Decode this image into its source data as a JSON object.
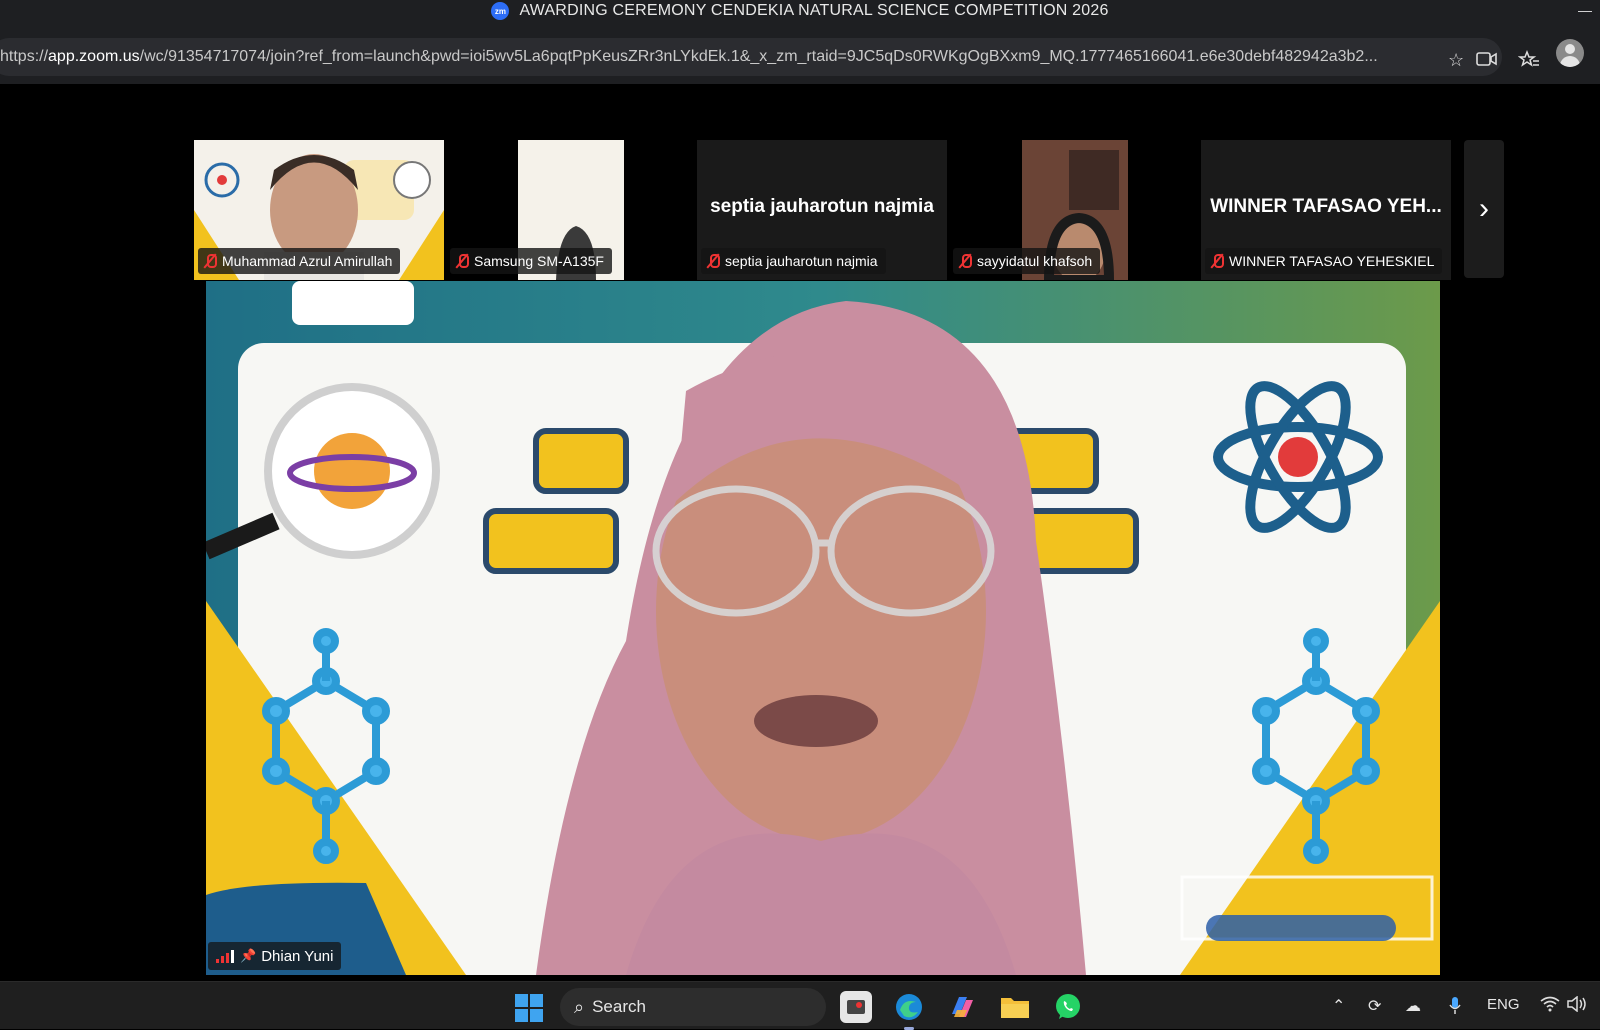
{
  "window": {
    "title": "AWARDING CEREMONY CENDEKIA NATURAL SCIENCE COMPETITION 2026",
    "app_badge": "zm"
  },
  "addressbar": {
    "url_prefix": "https://",
    "url_host": "app.zoom.us",
    "url_rest": "/wc/91354717074/join?ref_from=launch&pwd=ioi5wv5La6pqtPpKeusZRr3nLYkdEk.1&_x_zm_rtaid=9JC5qDs0RWKgOgBXxm9_MQ.1777465166041.e6e30debf482942a3b2..."
  },
  "gallery": {
    "tiles": [
      {
        "display": "",
        "name": "Muhammad Azrul Amirullah"
      },
      {
        "display": "",
        "name": "Samsung SM-A135F"
      },
      {
        "display": "septia jauharotun najmia",
        "name": "septia jauharotun najmia"
      },
      {
        "display": "",
        "name": "sayyidatul khafsoh"
      },
      {
        "display": "WINNER TAFASAO YEH...",
        "name": "WINNER TAFASAO YEHESKIEL"
      }
    ],
    "next_label": "›"
  },
  "speaker": {
    "name": "Dhian Yuni"
  },
  "taskbar": {
    "search_label": "Search",
    "language": "ENG"
  }
}
